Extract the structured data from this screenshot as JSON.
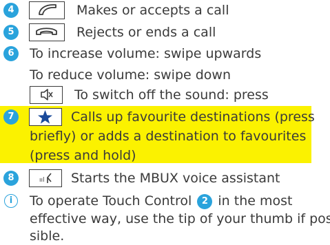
{
  "items": [
    {
      "badge": "4",
      "icon": "phone-accept-icon",
      "text": "Makes or accepts a call"
    },
    {
      "badge": "5",
      "icon": "phone-reject-icon",
      "text": "Rejects or ends a call"
    },
    {
      "badge": "6",
      "text": "To increase volume: swipe upwards"
    },
    {
      "text": "To reduce volume: swipe down"
    },
    {
      "icon": "speaker-mute-icon",
      "text": "To switch off the sound: press"
    },
    {
      "badge": "7",
      "icon": "star-icon",
      "lines": [
        "Calls up favourite destinations (press",
        "briefly) or adds a destination to favourites",
        "(press and hold)"
      ]
    },
    {
      "badge": "8",
      "icon": "voice-assistant-icon",
      "text": "Starts the MBUX voice assistant"
    }
  ],
  "note": {
    "icon": "info-icon",
    "line1_before": "To operate Touch Control",
    "line1_badge": "2",
    "line1_after": "in the most",
    "line2": "effective way, use the tip of your thumb if pos-",
    "line3": "sible."
  },
  "colors": {
    "badge": "#2aa3dc",
    "highlight": "#fbf200",
    "text": "#3a3a3a"
  }
}
